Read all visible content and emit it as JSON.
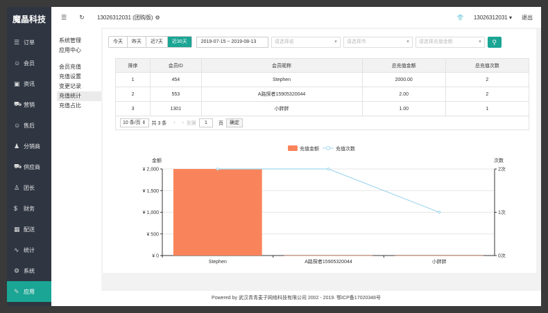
{
  "brand": "魔晶科技",
  "nav": [
    {
      "icon": "☰",
      "icon_name": "list-icon",
      "label": "订单"
    },
    {
      "icon": "☺",
      "icon_name": "user-icon",
      "label": "会员"
    },
    {
      "icon": "▣",
      "icon_name": "news-icon",
      "label": "资讯"
    },
    {
      "icon": "⛟",
      "icon_name": "cart-icon",
      "label": "营销"
    },
    {
      "icon": "☺",
      "icon_name": "smile-icon",
      "label": "售后"
    },
    {
      "icon": "♟",
      "icon_name": "users-icon",
      "label": "分销商"
    },
    {
      "icon": "⛟",
      "icon_name": "cart-icon",
      "label": "供应商"
    },
    {
      "icon": "♙",
      "icon_name": "person-icon",
      "label": "团长"
    },
    {
      "icon": "$",
      "icon_name": "dollar-icon",
      "label": "财务"
    },
    {
      "icon": "▦",
      "icon_name": "calendar-icon",
      "label": "配送"
    },
    {
      "icon": "∿",
      "icon_name": "chart-icon",
      "label": "统计"
    },
    {
      "icon": "⚙",
      "icon_name": "gear-icon",
      "label": "系统"
    },
    {
      "icon": "✎",
      "icon_name": "edit-icon",
      "label": "应用",
      "active": true
    }
  ],
  "topbar": {
    "menu_icon": "☰",
    "refresh_icon": "↻",
    "shop_name": "13026312031 (团购版)",
    "shop_gear": "⚙",
    "shirt_icon": "👕",
    "account": "13026312031 ▾",
    "logout": "退出"
  },
  "subnav": {
    "groups": [
      [
        "系统管理",
        "应用中心"
      ],
      [
        "会员充值",
        "充值设置",
        "变更记录",
        "充值统计",
        "充值占比"
      ]
    ],
    "active": "充值统计"
  },
  "filter": {
    "ranges": [
      "今天",
      "昨天",
      "近7天",
      "近30天"
    ],
    "active_range": "近30天",
    "date_range": "2019-07-15 ~ 2019-08-13",
    "province_placeholder": "请选择省",
    "city_placeholder": "请选择市",
    "amount_placeholder": "请选择充值金额",
    "search_icon": "⚲"
  },
  "table": {
    "headers": [
      "排序",
      "会员ID",
      "会员昵称",
      "总充值金额",
      "总充值次数"
    ],
    "rows": [
      [
        "1",
        "454",
        "Stephen",
        "2000.00",
        "2"
      ],
      [
        "2",
        "553",
        "A路探者15905320044",
        "2.00",
        "2"
      ],
      [
        "3",
        "1301",
        "小胖胖",
        "1.00",
        "1"
      ]
    ]
  },
  "pager": {
    "page_size": "10 条/页 ⇕",
    "total": "共 3 条",
    "prev": "‹",
    "next": "›",
    "goto": "到第",
    "page": "1",
    "page_unit": "页",
    "confirm": "确定"
  },
  "chart_data": {
    "type": "bar+line",
    "categories": [
      "Stephen",
      "A路探者15905320044",
      "小胖胖"
    ],
    "series": [
      {
        "name": "充值金额",
        "type": "bar",
        "axis": "left",
        "color": "#f9845b",
        "values": [
          2000,
          2,
          1
        ]
      },
      {
        "name": "充值次数",
        "type": "line",
        "axis": "right",
        "color": "#9fd6ee",
        "values": [
          2,
          2,
          1
        ]
      }
    ],
    "y_left": {
      "label": "金额",
      "min": 0,
      "max": 2000,
      "ticks": [
        "¥ 0",
        "¥ 500",
        "¥ 1,000",
        "¥ 1,500",
        "¥ 2,000"
      ]
    },
    "y_right": {
      "label": "次数",
      "min": 0,
      "max": 2,
      "ticks": [
        "0次",
        "1次",
        "2次"
      ]
    },
    "legend_position": "top-center",
    "grid": true
  },
  "footer": "Powered by 武汉青青麦子网络科技有限公司 2002 - 2019. 鄂ICP备17020348号"
}
